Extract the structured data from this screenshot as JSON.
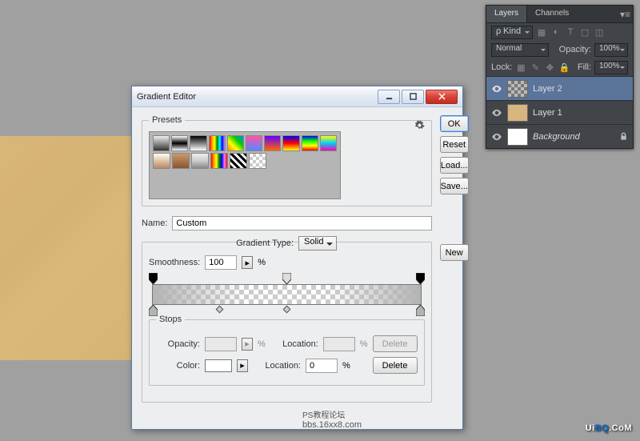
{
  "dialog": {
    "title": "Gradient Editor",
    "presets_label": "Presets",
    "name_label": "Name:",
    "name_value": "Custom",
    "gradient_type_label": "Gradient Type:",
    "gradient_type_value": "Solid",
    "smoothness_label": "Smoothness:",
    "smoothness_value": "100",
    "percent": "%",
    "stops_label": "Stops",
    "opacity_label": "Opacity:",
    "location_label": "Location:",
    "location_value": "0",
    "color_label": "Color:",
    "buttons": {
      "ok": "OK",
      "cancel": "Reset",
      "load": "Load...",
      "save": "Save...",
      "new": "New",
      "delete": "Delete"
    }
  },
  "layers": {
    "tab_layers": "Layers",
    "tab_channels": "Channels",
    "kind_label": "Kind",
    "blend_mode": "Normal",
    "opacity_label": "Opacity:",
    "opacity_value": "100%",
    "lock_label": "Lock:",
    "fill_label": "Fill:",
    "fill_value": "100%",
    "items": [
      {
        "name": "Layer 2",
        "thumb": "check",
        "active": true
      },
      {
        "name": "Layer 1",
        "thumb": "tan",
        "active": false
      },
      {
        "name": "Background",
        "thumb": "white",
        "active": false,
        "italic": true,
        "locked": true
      }
    ]
  },
  "watermark": {
    "l1": "PS教程论坛",
    "l2": "bbs.16xx8.com"
  },
  "brand": "UiBQ.CoM"
}
